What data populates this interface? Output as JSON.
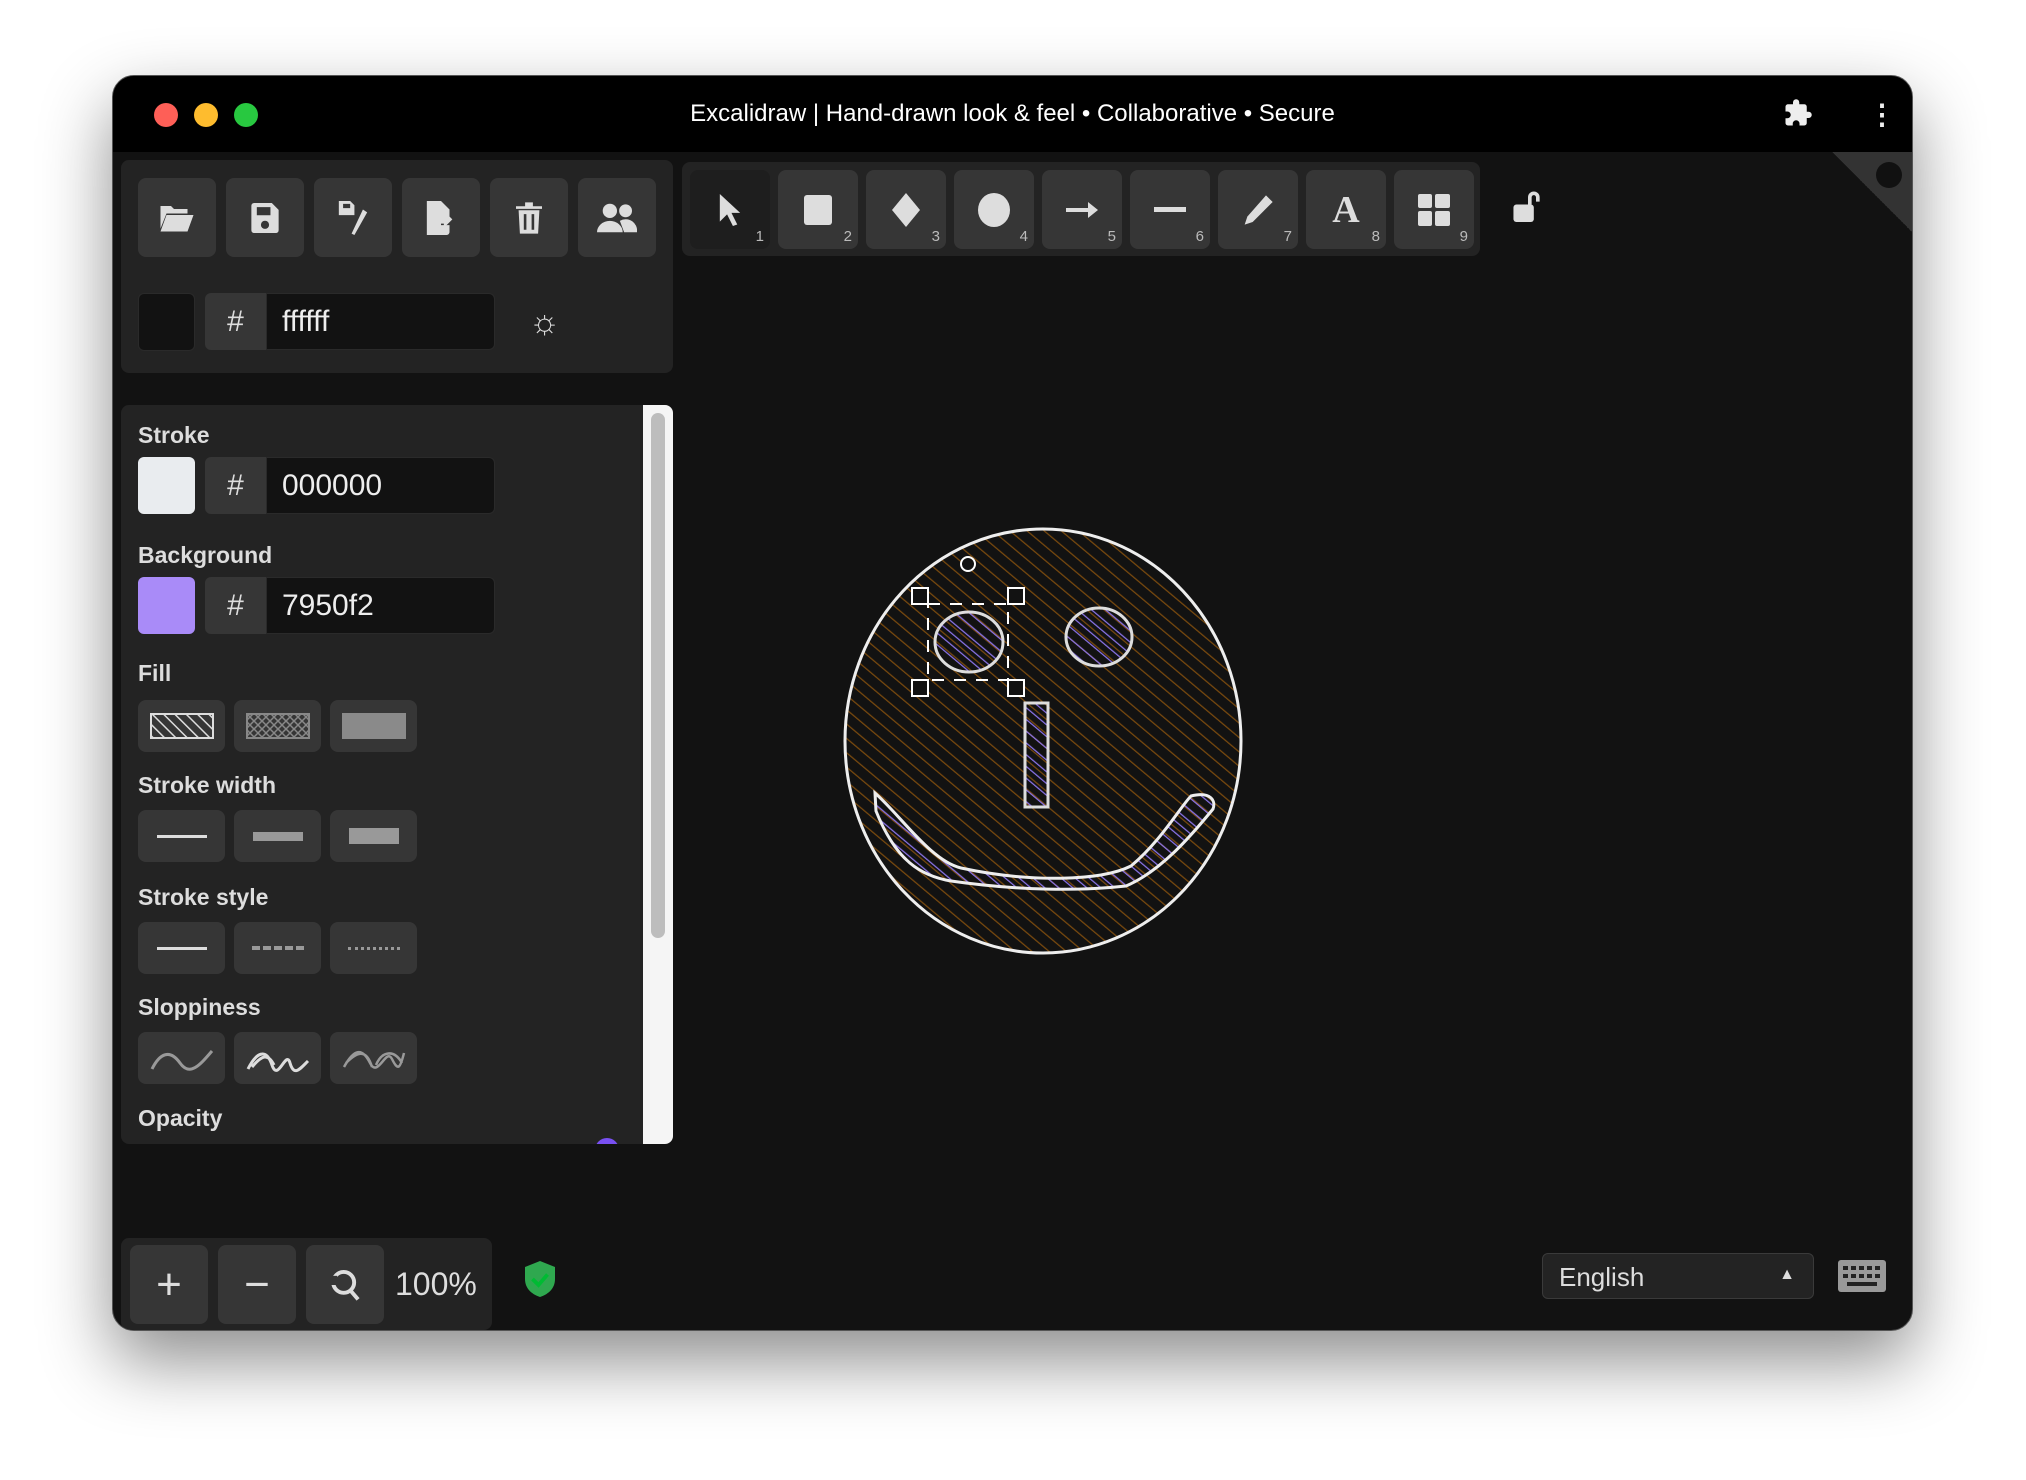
{
  "window": {
    "title": "Excalidraw | Hand-drawn look & feel • Collaborative • Secure"
  },
  "top_actions": [
    {
      "name": "open-icon"
    },
    {
      "name": "save-icon"
    },
    {
      "name": "save-as-icon"
    },
    {
      "name": "export-icon"
    },
    {
      "name": "clear-canvas-icon"
    },
    {
      "name": "collaborate-icon"
    }
  ],
  "canvas_bg": {
    "hash": "#",
    "value": "ffffff"
  },
  "tools": [
    {
      "name": "selection",
      "key": "1"
    },
    {
      "name": "rectangle",
      "key": "2"
    },
    {
      "name": "diamond",
      "key": "3"
    },
    {
      "name": "ellipse",
      "key": "4"
    },
    {
      "name": "arrow",
      "key": "5"
    },
    {
      "name": "line",
      "key": "6"
    },
    {
      "name": "draw",
      "key": "7"
    },
    {
      "name": "text",
      "key": "8"
    },
    {
      "name": "library",
      "key": "9"
    }
  ],
  "props": {
    "stroke_label": "Stroke",
    "stroke_hash": "#",
    "stroke_value": "000000",
    "stroke_swatch": "#e9ecef",
    "background_label": "Background",
    "background_hash": "#",
    "background_value": "7950f2",
    "background_swatch": "#a98bf8",
    "fill_label": "Fill",
    "stroke_width_label": "Stroke width",
    "stroke_style_label": "Stroke style",
    "sloppiness_label": "Sloppiness",
    "opacity_label": "Opacity"
  },
  "zoom": {
    "level": "100%"
  },
  "language": {
    "selected": "English"
  },
  "colors": {
    "hachure": "#7a4a0e",
    "accent_fill": "#8a73e8",
    "stroke": "#eeeeee"
  }
}
